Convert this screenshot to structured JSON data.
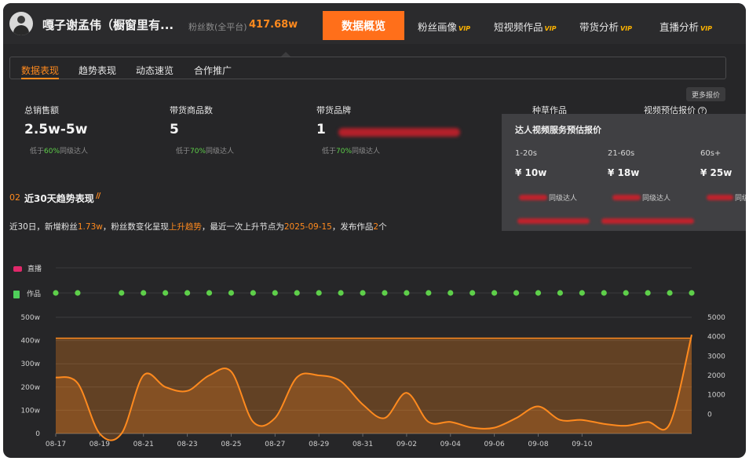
{
  "header": {
    "name": "嘎子谢孟伟（橱窗里有...",
    "fans_label": "粉丝数(全平台)",
    "fans_value": "417.68w",
    "nav": [
      {
        "label": "数据概览",
        "vip": ""
      },
      {
        "label": "粉丝画像",
        "vip": "VIP"
      },
      {
        "label": "短视频作品",
        "vip": "VIP"
      },
      {
        "label": "带货分析",
        "vip": "VIP"
      },
      {
        "label": "直播分析",
        "vip": "VIP"
      }
    ]
  },
  "tabs": [
    "数据表现",
    "趋势表现",
    "动态速览",
    "合作推广"
  ],
  "stats": [
    {
      "label": "总销售额",
      "value": "2.5w-5w",
      "compare_prefix": "低于",
      "compare_pct": "60%",
      "compare_suffix": "同级达人"
    },
    {
      "label": "带货商品数",
      "value": "5",
      "compare_prefix": "低于",
      "compare_pct": "70%",
      "compare_suffix": "同级达人"
    },
    {
      "label": "带货品牌",
      "value": "1",
      "compare_prefix": "低于",
      "compare_pct": "70%",
      "compare_suffix": "同级达人"
    }
  ],
  "extra_labels": {
    "seeding": "种草作品",
    "video_quote": "视频预估报价",
    "more_quotes": "更多报价"
  },
  "quote_popup": {
    "title": "达人视频服务预估报价",
    "durations": [
      "1-20s",
      "21-60s",
      "60s+"
    ],
    "prices": [
      "¥ 10w",
      "¥ 18w",
      "¥ 25w"
    ],
    "peer_label": "同级达人"
  },
  "trend": {
    "number": "02",
    "title": "近30天趋势表现",
    "summary": {
      "p1": "近30日，新增粉丝",
      "fans": "1.73w",
      "p2": "，粉丝数变化呈现",
      "trend": "上升趋势",
      "p3": "，最近一次上升节点为",
      "date": "2025-09-15",
      "p4": "，发布作品",
      "works": "2",
      "p5": "个"
    },
    "legend_live": "直播",
    "legend_works": "作品"
  },
  "chart_data": {
    "type": "area",
    "x": [
      "08-17",
      "08-18",
      "08-19",
      "08-20",
      "08-21",
      "08-22",
      "08-23",
      "08-24",
      "08-25",
      "08-26",
      "08-27",
      "08-28",
      "08-29",
      "08-30",
      "08-31",
      "09-01",
      "09-02",
      "09-03",
      "09-04",
      "09-05",
      "09-06",
      "09-07",
      "09-08",
      "09-09",
      "09-10",
      "09-11",
      "09-12",
      "09-13",
      "09-14",
      "09-15"
    ],
    "x_tick_labels": [
      "08-17",
      "08-19",
      "08-21",
      "08-23",
      "08-25",
      "08-27",
      "08-29",
      "08-31",
      "09-02",
      "09-04",
      "09-06",
      "09-08",
      "09-10"
    ],
    "left_axis": {
      "ticks": [
        "0",
        "100w",
        "200w",
        "300w",
        "400w",
        "500w"
      ],
      "ylim": [
        0,
        500
      ]
    },
    "right_axis": {
      "ticks": [
        "0",
        "1000",
        "2000",
        "3000",
        "4000",
        "5000"
      ],
      "ylim": [
        -1000,
        5000
      ]
    },
    "series": [
      {
        "axis": "left",
        "color": "#ff8a1e",
        "values": [
          410,
          410,
          410,
          410,
          410,
          410,
          410,
          410,
          410,
          410,
          410,
          410,
          410,
          410,
          410,
          410,
          410,
          410,
          410,
          410,
          410,
          410,
          410,
          410,
          410,
          410,
          410,
          410,
          410,
          410
        ]
      },
      {
        "axis": "right",
        "color": "#ff8a1e",
        "values": [
          1900,
          1600,
          -1000,
          -1000,
          2000,
          1400,
          1200,
          2000,
          2200,
          -400,
          -200,
          1900,
          2000,
          1700,
          500,
          -200,
          1100,
          -400,
          -400,
          -700,
          -700,
          -200,
          400,
          -300,
          -300,
          -500,
          -600,
          -400,
          -500,
          4100
        ]
      }
    ],
    "work_markers": [
      "08-17",
      "08-18",
      "08-20",
      "08-21",
      "08-22",
      "08-23",
      "08-24",
      "08-25",
      "08-26",
      "08-27",
      "08-28",
      "08-29",
      "08-30",
      "08-31",
      "09-01",
      "09-02",
      "09-03",
      "09-04",
      "09-05",
      "09-06",
      "09-07",
      "09-08",
      "09-09",
      "09-10",
      "09-11",
      "09-12",
      "09-13",
      "09-14",
      "09-15"
    ]
  }
}
